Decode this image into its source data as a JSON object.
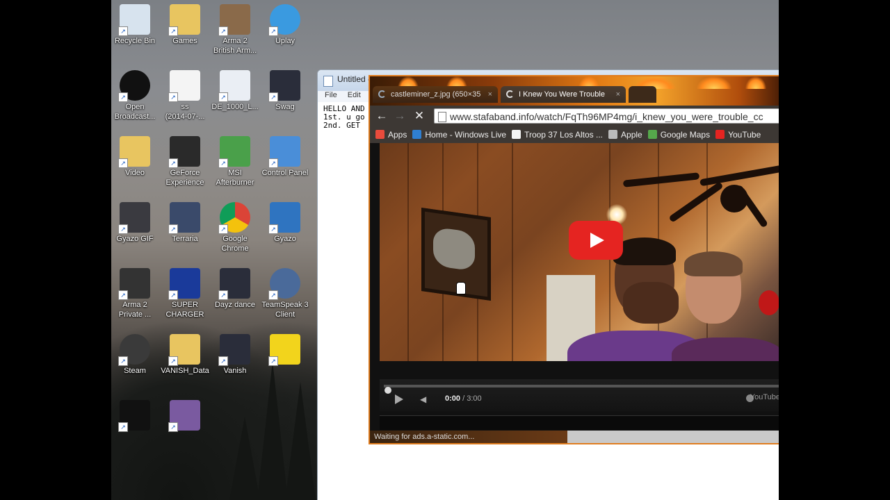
{
  "desktop": {
    "icons": [
      {
        "label": "Recycle Bin",
        "icon": "recycle-bin-icon"
      },
      {
        "label": "Games",
        "icon": "folder-icon"
      },
      {
        "label": "Arma 2\nBritish Arm...",
        "icon": "arma-icon"
      },
      {
        "label": "Uplay",
        "icon": "uplay-icon"
      },
      {
        "label": "Open\nBroadcast...",
        "icon": "obs-icon"
      },
      {
        "label": "ss\n(2014-07-...",
        "icon": "screenshot-file-icon"
      },
      {
        "label": "DE_1000_L...",
        "icon": "settings-file-icon"
      },
      {
        "label": "Swag",
        "icon": "video-file-icon"
      },
      {
        "label": "Video",
        "icon": "folder-icon"
      },
      {
        "label": "GeForce\nExperience",
        "icon": "geforce-icon"
      },
      {
        "label": "MSI\nAfterburner",
        "icon": "msi-afterburner-icon"
      },
      {
        "label": "Control Panel",
        "icon": "control-panel-icon"
      },
      {
        "label": "Gyazo GIF",
        "icon": "gyazo-gif-icon"
      },
      {
        "label": "Terraria",
        "icon": "terraria-icon"
      },
      {
        "label": "Google\nChrome",
        "icon": "chrome-icon"
      },
      {
        "label": "Gyazo",
        "icon": "gyazo-icon"
      },
      {
        "label": "Arma 2\nPrivate ...",
        "icon": "arma-private-icon"
      },
      {
        "label": "SUPER\nCHARGER",
        "icon": "supercharger-icon"
      },
      {
        "label": "Dayz dance",
        "icon": "video-file-icon"
      },
      {
        "label": "TeamSpeak 3\nClient",
        "icon": "teamspeak-icon"
      },
      {
        "label": "Steam",
        "icon": "steam-icon"
      },
      {
        "label": "VANISH_Data",
        "icon": "folder-icon"
      },
      {
        "label": "Vanish",
        "icon": "video-file-icon"
      },
      {
        "label": "",
        "icon": "globe-app-icon"
      },
      {
        "label": "",
        "icon": "v-app-icon"
      },
      {
        "label": "",
        "icon": "game-app-icon"
      }
    ]
  },
  "notepad": {
    "title": "Untitled -",
    "menu": [
      "File",
      "Edit"
    ],
    "text": "HELLO AND\n1st. u go\n2nd. GET"
  },
  "browser": {
    "tabs": [
      {
        "label": "castleminer_z.jpg (650×35",
        "close": "×"
      },
      {
        "label": "I Knew You Were Trouble",
        "close": "×"
      }
    ],
    "url": "www.stafaband.info/watch/FqTh96MP4mg/i_knew_you_were_trouble_cc",
    "bookmarks": [
      {
        "label": "Apps",
        "color": "#e94b3c"
      },
      {
        "label": "Home - Windows Live",
        "color": "#2f7fd1"
      },
      {
        "label": "Troop 37 Los Altos ...",
        "color": "#f4f4f4"
      },
      {
        "label": "Apple",
        "color": "#bbbbbb"
      },
      {
        "label": "Google Maps",
        "color": "#55a84b"
      },
      {
        "label": "YouTube",
        "color": "#e52421"
      }
    ],
    "status": "Waiting for ads.a-static.com...",
    "player": {
      "time_current": "0:00",
      "time_total": " / 3:00",
      "progress": 0,
      "logo": "YouTube"
    }
  }
}
